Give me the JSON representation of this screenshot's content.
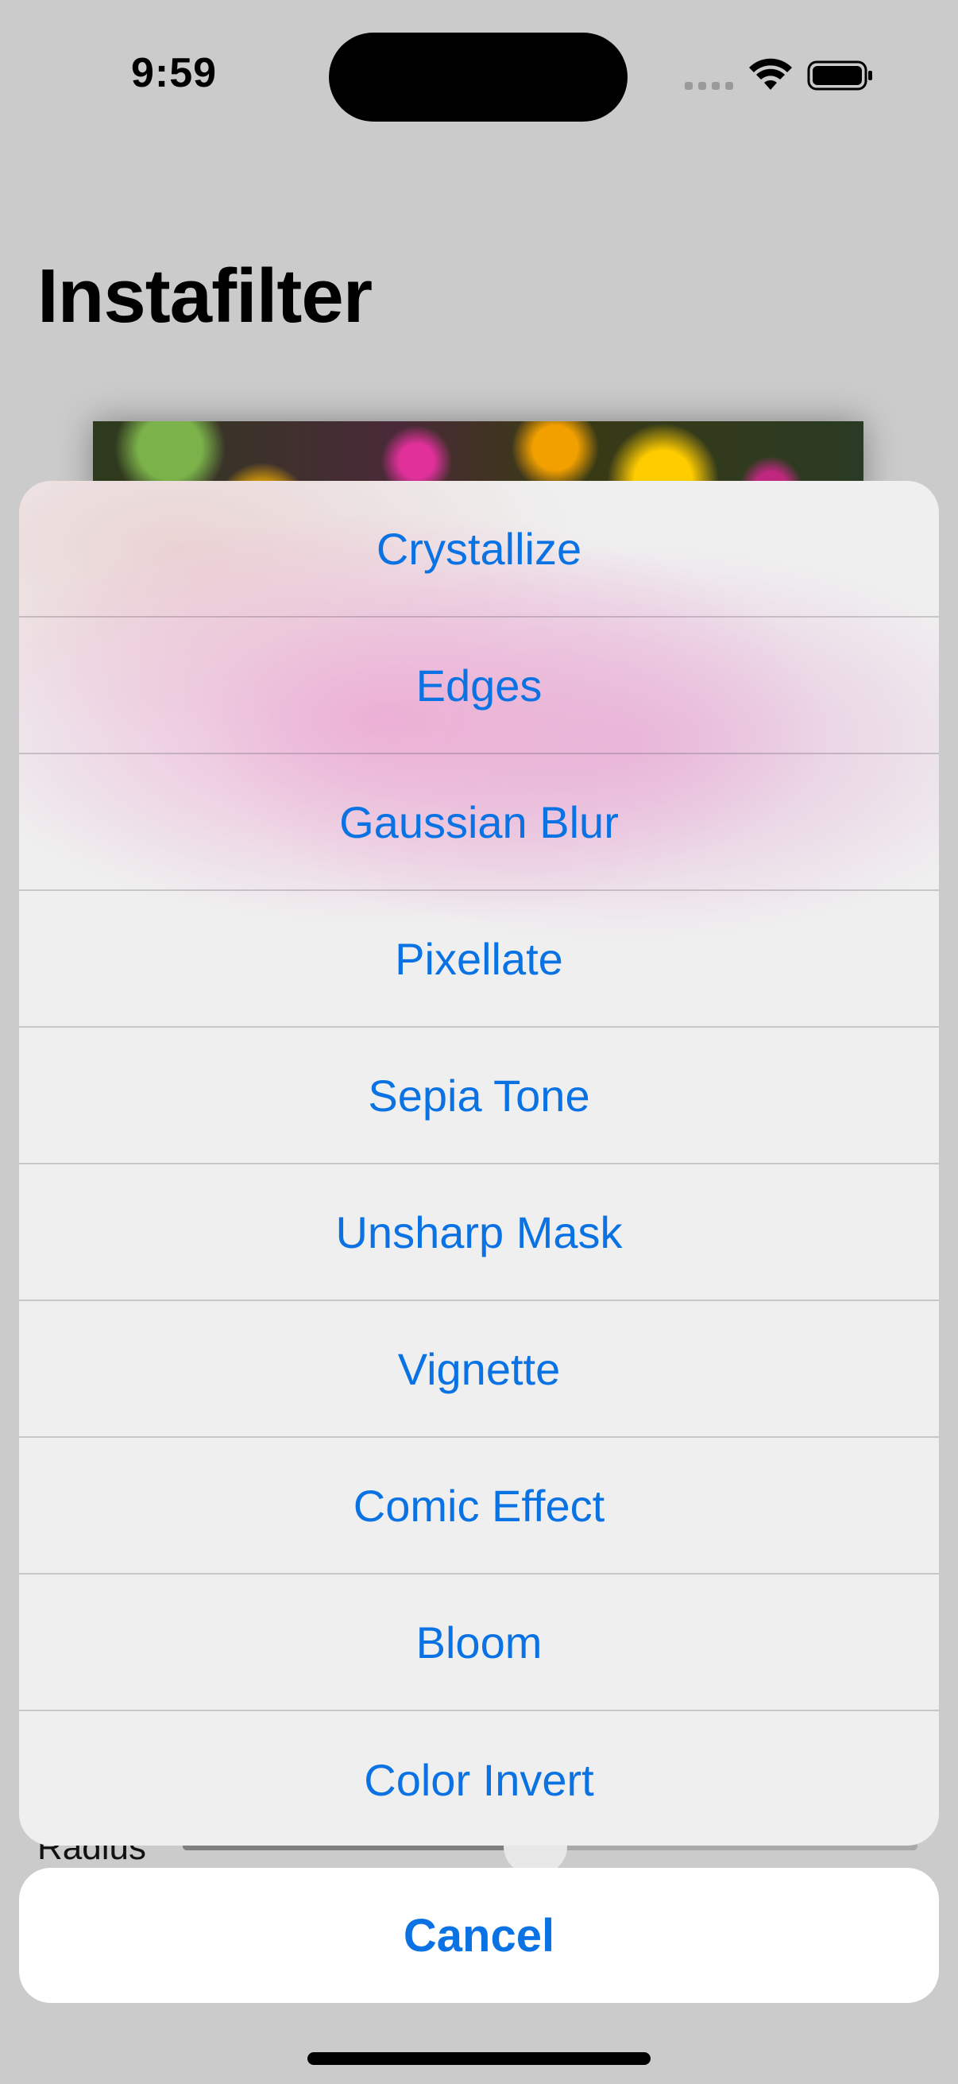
{
  "status_bar": {
    "time": "9:59",
    "icons": [
      "cellular-signal-icon",
      "wifi-icon",
      "battery-icon"
    ]
  },
  "screen": {
    "title": "Instafilter",
    "slider_label": "Radius",
    "slider_value_fraction": 0.48
  },
  "action_sheet": {
    "items": [
      {
        "label": "Crystallize"
      },
      {
        "label": "Edges"
      },
      {
        "label": "Gaussian Blur"
      },
      {
        "label": "Pixellate"
      },
      {
        "label": "Sepia Tone"
      },
      {
        "label": "Unsharp Mask"
      },
      {
        "label": "Vignette"
      },
      {
        "label": "Comic Effect"
      },
      {
        "label": "Bloom"
      },
      {
        "label": "Color Invert"
      }
    ],
    "cancel_label": "Cancel"
  },
  "colors": {
    "accent": "#0a72e3",
    "background_dim": "#cbcbcb",
    "sheet_background": "#efefef"
  }
}
